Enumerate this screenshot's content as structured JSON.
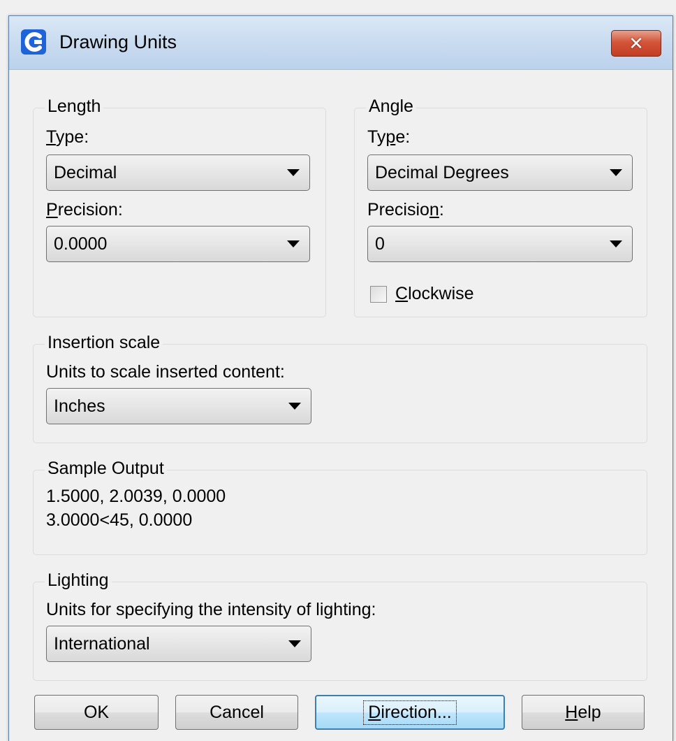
{
  "window": {
    "title": "Drawing Units",
    "close_label": "✕",
    "accent": "#2b6bd6"
  },
  "length": {
    "legend": "Length",
    "type_label_hot": "T",
    "type_label_rest": "ype:",
    "type_value": "Decimal",
    "precision_label_hot": "P",
    "precision_label_rest": "recision:",
    "precision_value": "0.0000"
  },
  "angle": {
    "legend": "Angle",
    "type_label_pre": "Ty",
    "type_label_hot": "p",
    "type_label_rest": "e:",
    "type_value": "Decimal Degrees",
    "precision_label_pre": "Precisio",
    "precision_label_hot": "n",
    "precision_label_rest": ":",
    "precision_value": "0",
    "clockwise_hot": "C",
    "clockwise_rest": "lockwise",
    "clockwise_checked": false
  },
  "insertion": {
    "legend": "Insertion scale",
    "label": "Units to scale inserted content:",
    "value": "Inches"
  },
  "sample": {
    "legend": "Sample Output",
    "line1": "1.5000, 2.0039, 0.0000",
    "line2": "3.0000<45, 0.0000"
  },
  "lighting": {
    "legend": "Lighting",
    "label": "Units for specifying the intensity of lighting:",
    "value": "International"
  },
  "buttons": {
    "ok": "OK",
    "cancel": "Cancel",
    "direction_hot": "D",
    "direction_rest": "irection...",
    "help_hot": "H",
    "help_rest": "elp"
  }
}
